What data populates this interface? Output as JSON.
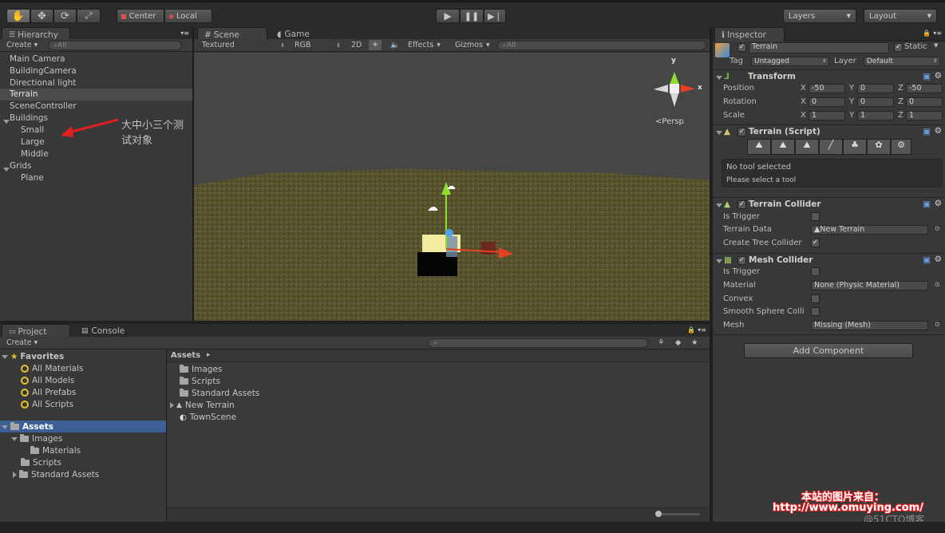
{
  "toolbar": {
    "pivot": "Center",
    "space": "Local",
    "layers": "Layers",
    "layout": "Layout"
  },
  "hierarchy": {
    "tab": "Hierarchy",
    "create": "Create",
    "search_placeholder": "All",
    "items": [
      "Main Camera",
      "BuildingCamera",
      "Directional light",
      "Terrain",
      "SceneController",
      "Buildings",
      "Small",
      "Large",
      "Middle",
      "Grids",
      "Plane"
    ],
    "selected": "Terrain"
  },
  "annotation": {
    "text": "大中小三个测试对象",
    "color": "#f5f000"
  },
  "scene": {
    "tab_scene": "Scene",
    "tab_game": "Game",
    "render_mode": "Textured",
    "color_mode": "RGB",
    "mode_2d": "2D",
    "effects": "Effects",
    "gizmos": "Gizmos",
    "search_placeholder": "All",
    "persp": "Persp",
    "gizmo_y": "y",
    "gizmo_x": "x"
  },
  "inspector": {
    "tab": "Inspector",
    "object_name": "Terrain",
    "static": "Static",
    "tag_label": "Tag",
    "tag_value": "Untagged",
    "layer_label": "Layer",
    "layer_value": "Default",
    "transform": {
      "title": "Transform",
      "rows": [
        {
          "label": "Position",
          "x": "-50",
          "y": "0",
          "z": "-50"
        },
        {
          "label": "Rotation",
          "x": "0",
          "y": "0",
          "z": "0"
        },
        {
          "label": "Scale",
          "x": "1",
          "y": "1",
          "z": "1"
        }
      ],
      "axis_x": "X",
      "axis_y": "Y",
      "axis_z": "Z"
    },
    "terrain_script": {
      "title": "Terrain (Script)",
      "help_line1": "No tool selected",
      "help_line2": "Please select a tool"
    },
    "terrain_collider": {
      "title": "Terrain Collider",
      "is_trigger": "Is Trigger",
      "terrain_data": "Terrain Data",
      "terrain_data_value": "New Terrain",
      "create_tree": "Create Tree Collider"
    },
    "mesh_collider": {
      "title": "Mesh Collider",
      "is_trigger": "Is Trigger",
      "material": "Material",
      "material_value": "None (Physic Material)",
      "convex": "Convex",
      "smooth": "Smooth Sphere Colli",
      "mesh": "Mesh",
      "mesh_value": "Missing (Mesh)"
    },
    "add_component": "Add Component"
  },
  "project": {
    "tab_project": "Project",
    "tab_console": "Console",
    "create": "Create",
    "favorites": "Favorites",
    "fav_items": [
      "All Materials",
      "All Models",
      "All Prefabs",
      "All Scripts"
    ],
    "assets": "Assets",
    "tree": [
      "Images",
      "Materials",
      "Scripts",
      "Standard Assets"
    ],
    "breadcrumb": "Assets",
    "files": [
      "Images",
      "Scripts",
      "Standard Assets",
      "New Terrain",
      "TownScene"
    ]
  },
  "watermark": {
    "line1": "本站的图片来自：",
    "line2": "http://www.omuying.com/",
    "blog": "@51CTO博客"
  }
}
